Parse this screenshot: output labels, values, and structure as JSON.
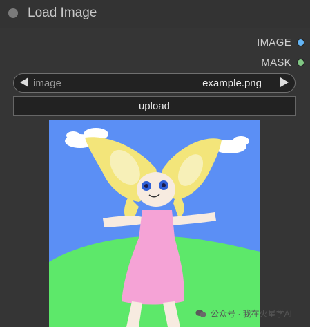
{
  "node": {
    "title": "Load Image"
  },
  "outputs": [
    {
      "label": "IMAGE",
      "color": "#64b5f6"
    },
    {
      "label": "MASK",
      "color": "#81c784"
    }
  ],
  "image_widget": {
    "label": "image",
    "value": "example.png"
  },
  "upload_button": {
    "label": "upload"
  },
  "preview": {
    "description_icon": "child-drawing-image"
  },
  "watermark": {
    "text": "公众号 · 我在火星学AI"
  }
}
